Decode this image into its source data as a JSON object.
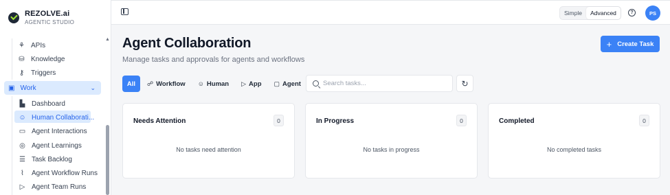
{
  "brand": {
    "name": "REZOLVE.ai",
    "subtitle": "AGENTIC STUDIO"
  },
  "sidebar": {
    "top_items": [
      {
        "label": "APIs",
        "icon": "api-icon"
      },
      {
        "label": "Knowledge",
        "icon": "database-icon"
      },
      {
        "label": "Triggers",
        "icon": "key-icon"
      }
    ],
    "group": {
      "label": "Work",
      "icon": "briefcase-icon",
      "expanded": true
    },
    "sub_items": [
      {
        "label": "Dashboard",
        "icon": "bar-chart-icon",
        "active": false
      },
      {
        "label": "Human Collaborati...",
        "icon": "users-icon",
        "active": true
      },
      {
        "label": "Agent Interactions",
        "icon": "message-icon",
        "active": false
      },
      {
        "label": "Agent Learnings",
        "icon": "brain-icon",
        "active": false
      },
      {
        "label": "Task Backlog",
        "icon": "checklist-icon",
        "active": false
      },
      {
        "label": "Agent Workflow Runs",
        "icon": "activity-icon",
        "active": false
      },
      {
        "label": "Agent Team Runs",
        "icon": "play-icon",
        "active": false
      }
    ]
  },
  "topbar": {
    "mode": {
      "simple": "Simple",
      "advanced": "Advanced",
      "selected": "Advanced"
    },
    "avatar_initials": "PS"
  },
  "page": {
    "title": "Agent Collaboration",
    "subtitle": "Manage tasks and approvals for agents and workflows",
    "create_button": "Create Task"
  },
  "filters": {
    "items": [
      {
        "label": "All",
        "icon": "",
        "active": true
      },
      {
        "label": "Workflow",
        "icon": "workflow-icon"
      },
      {
        "label": "Human",
        "icon": "user-icon"
      },
      {
        "label": "App",
        "icon": "play-icon"
      },
      {
        "label": "Agent",
        "icon": "bot-icon"
      }
    ],
    "search_placeholder": "Search tasks..."
  },
  "columns": [
    {
      "title": "Needs Attention",
      "count": "0",
      "empty": "No tasks need attention"
    },
    {
      "title": "In Progress",
      "count": "0",
      "empty": "No tasks in progress"
    },
    {
      "title": "Completed",
      "count": "0",
      "empty": "No completed tasks"
    }
  ],
  "colors": {
    "accent": "#3b82f6",
    "active_bg": "#dbeafe",
    "active_text": "#2563eb"
  }
}
